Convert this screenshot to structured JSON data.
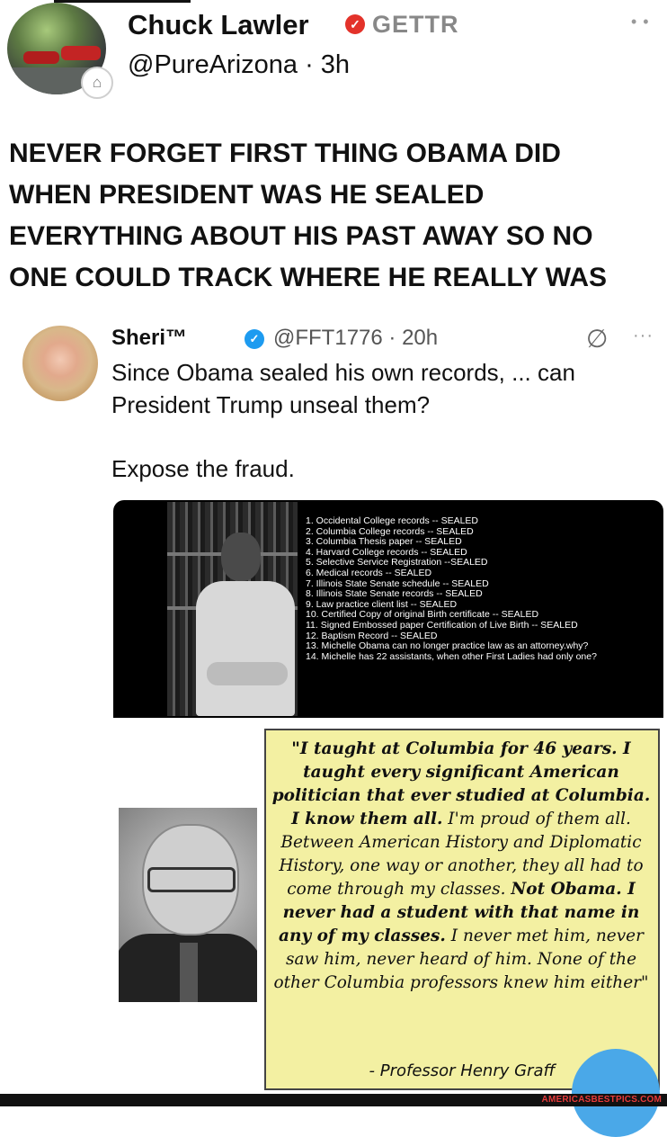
{
  "post": {
    "author_name": "Chuck Lawler",
    "platform_tag": "GETTR",
    "handle_time": "@PureArizona · 3h",
    "text_lines": [
      "NEVER FORGET FIRST THING OBAMA DID",
      "WHEN PRESIDENT WAS HE SEALED",
      "EVERYTHING ABOUT HIS PAST AWAY SO NO",
      "ONE COULD TRACK WHERE HE REALLY WAS"
    ]
  },
  "quoted": {
    "author_name": "Sheri™",
    "handle_time": "@FFT1776 · 20h",
    "text_lines": [
      "Since Obama sealed his own records, ... can",
      "President Trump unseal them?"
    ],
    "text_line2": "Expose the fraud."
  },
  "image": {
    "records": [
      "1. Occidental College records -- SEALED",
      "2. Columbia College records -- SEALED",
      "3. Columbia Thesis paper -- SEALED",
      "4. Harvard College records -- SEALED",
      "5. Selective Service Registration --SEALED",
      "6. Medical records -- SEALED",
      "7. Illinois State Senate schedule -- SEALED",
      "8. Illinois State Senate records -- SEALED",
      "9. Law practice client list -- SEALED",
      "10. Certified Copy of original Birth certificate -- SEALED",
      "11. Signed Embossed paper Certification of Live Birth -- SEALED",
      "12. Baptism Record -- SEALED",
      "13. Michelle Obama can no longer practice law as an attorney.why?",
      "14. Michelle has 22 assistants, when other First Ladies had only one?"
    ],
    "quote_parts": {
      "p1": "\"I taught at Columbia for 46 years. I taught every significant American politician that ever studied at Columbia. I know them all.",
      "p2": " I'm proud of them all. Between American History and Diplomatic History, one way or another, they all had to come through my classes. ",
      "p3": "Not Obama. I never had a student with that name in any of my classes.",
      "p4": " I never met him, never saw him, never heard of him. None of the other Columbia professors knew him either\""
    },
    "attribution": "- Professor Henry Graff"
  },
  "watermark": "AMERICASBESTPICS.COM",
  "icons": {
    "verified_main": "verified-flame-icon",
    "verified_quote": "verified-check-icon",
    "quote_action": "slash-circle-icon",
    "more": "more-dots-icon"
  },
  "colors": {
    "verified_main": "#e3322a",
    "verified_quote": "#1d9bf0",
    "quote_box": "#f3f0a2",
    "watermark": "#e83a3a"
  }
}
